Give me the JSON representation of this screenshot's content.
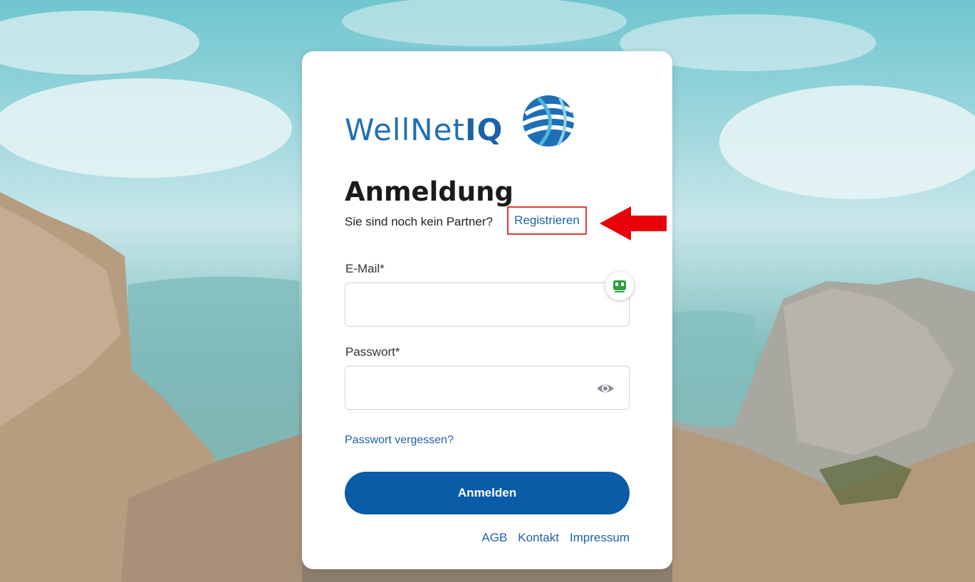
{
  "brand": {
    "name_part1": "WellNet",
    "name_part2": "IQ"
  },
  "login": {
    "title": "Anmeldung",
    "subline": "Sie sind noch kein Partner?",
    "register_link": "Registrieren",
    "email_label": "E-Mail*",
    "email_value": "",
    "password_label": "Passwort*",
    "password_value": "",
    "forgot_password": "Passwort vergessen?",
    "submit_label": "Anmelden"
  },
  "footer": {
    "links": [
      "AGB",
      "Kontakt",
      "Impressum"
    ]
  },
  "icons": {
    "logo": "globe-logo-icon",
    "password_toggle": "eye-icon",
    "extension_badge": "password-manager-icon",
    "annotation": "red-arrow-icon"
  },
  "colors": {
    "primary": "#0b5ca6",
    "link": "#1f63a8",
    "highlight": "#e23a3a",
    "arrow": "#e8000b"
  }
}
